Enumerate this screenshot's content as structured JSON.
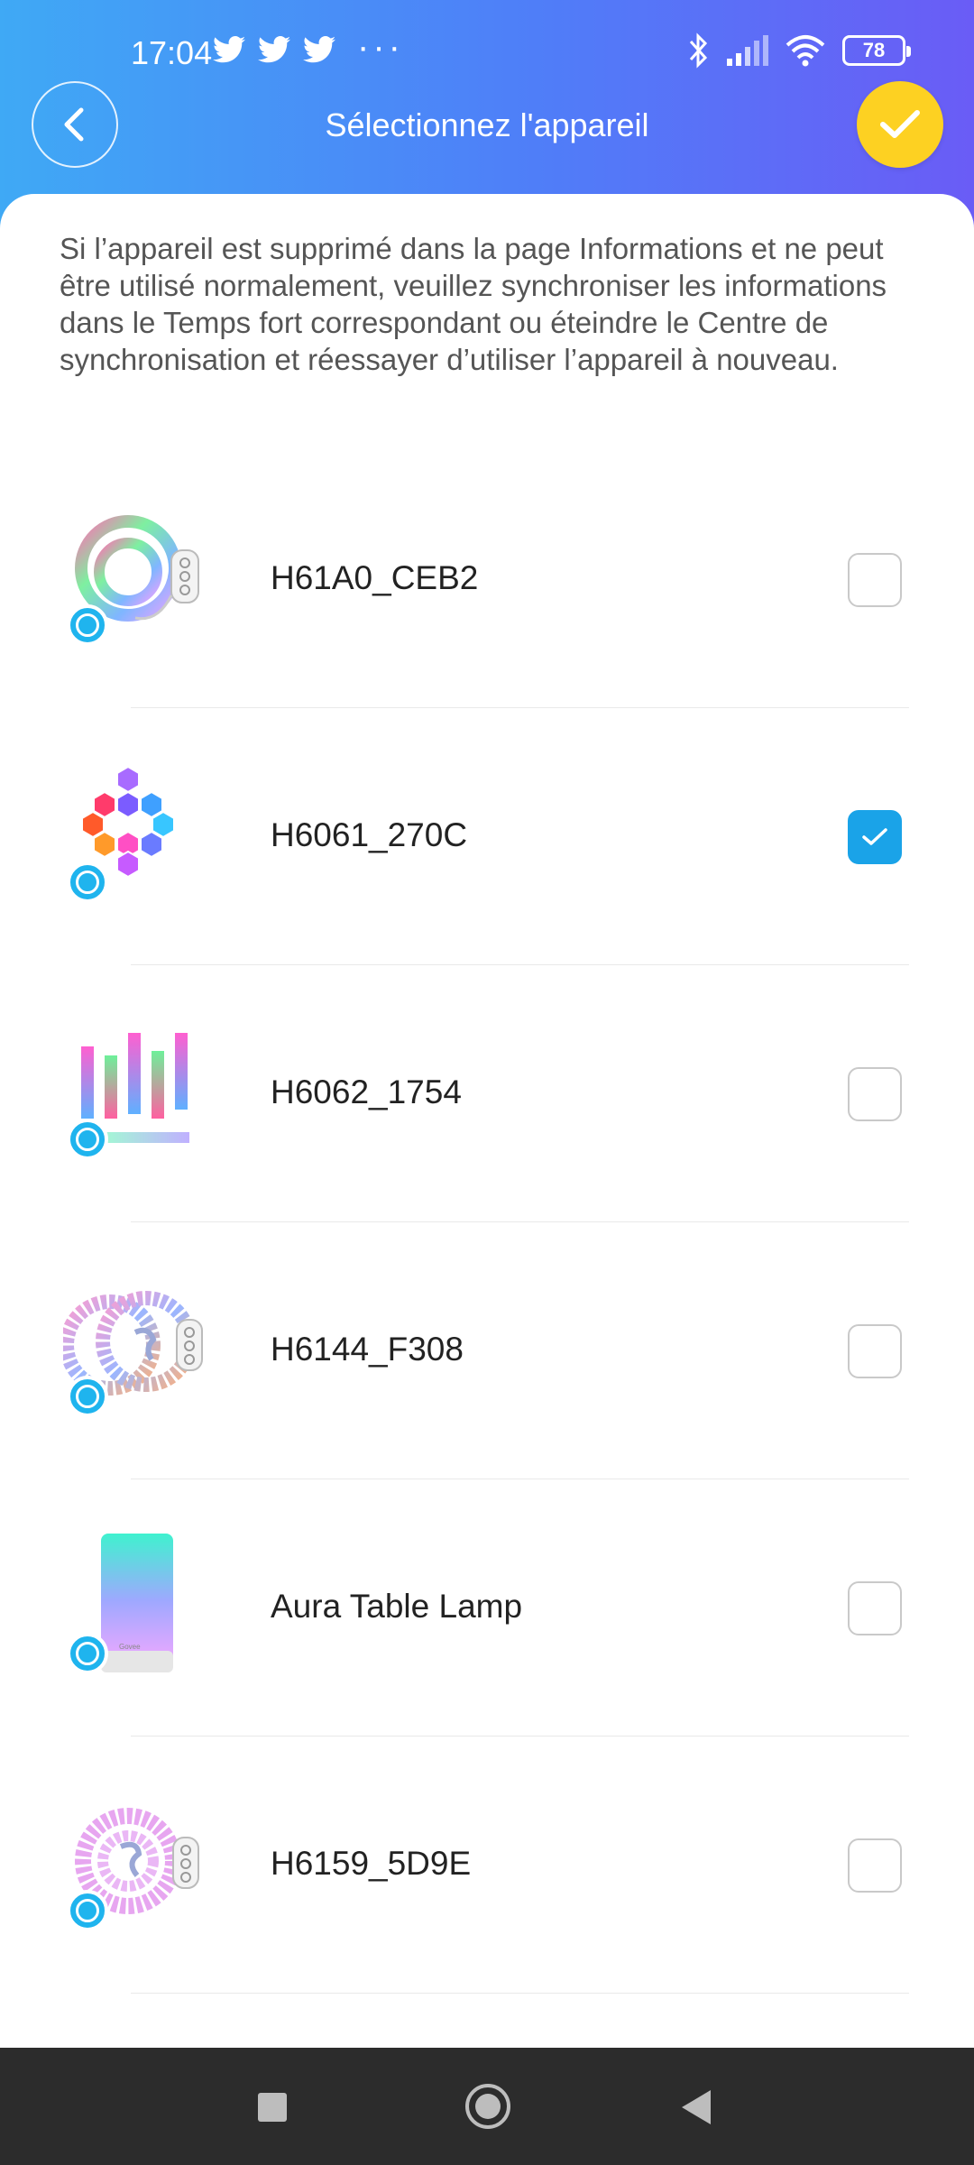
{
  "status_bar": {
    "time": "17:04",
    "battery": "78",
    "notification_icons": [
      "twitter-icon",
      "twitter-icon",
      "twitter-icon"
    ],
    "more": "···"
  },
  "header": {
    "title": "Sélectionnez l'appareil"
  },
  "notice": "Si l’appareil est supprimé dans la page Informations et ne peut être utilisé normalement, veuillez synchroniser les informations dans le Temps fort correspondant ou éteindre le Centre de synchronisation et réessayer d’utiliser l’appareil à nouveau.",
  "devices": [
    {
      "name": "H61A0_CEB2",
      "checked": false,
      "icon": "rgb-strip-coil"
    },
    {
      "name": "H6061_270C",
      "checked": true,
      "icon": "hexagon-panels"
    },
    {
      "name": "H6062_1754",
      "checked": false,
      "icon": "light-bars"
    },
    {
      "name": "H6144_F308",
      "checked": false,
      "icon": "led-strip-reels"
    },
    {
      "name": "Aura Table Lamp",
      "checked": false,
      "icon": "table-lamp"
    },
    {
      "name": "H6159_5D9E",
      "checked": false,
      "icon": "led-strip-reel"
    }
  ],
  "colors": {
    "header_gradient_start": "#3fa9f5",
    "header_gradient_end": "#6a5cf6",
    "confirm_button": "#fdd122",
    "checkbox_checked": "#1aa3e8",
    "alexa_badge": "#1fb4ee"
  }
}
